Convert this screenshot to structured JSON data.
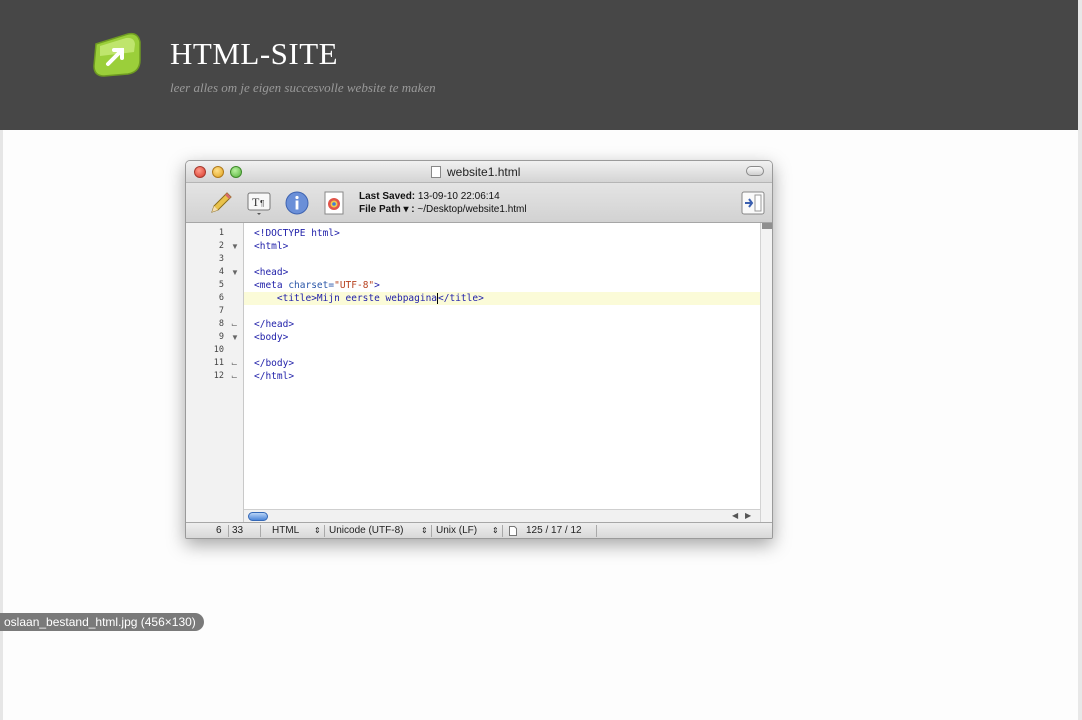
{
  "site": {
    "title": "HTML-SITE",
    "tagline": "leer alles om je eigen succesvolle website te maken",
    "logo_icon": "green-arrow-logo-icon"
  },
  "window": {
    "title": "website1.html",
    "toolbar": {
      "icons": [
        "pencil-icon",
        "text-format-icon",
        "info-icon",
        "preview-icon",
        "split-view-icon"
      ],
      "last_saved_label": "Last Saved:",
      "last_saved_value": "13-09-10 22:06:14",
      "file_path_label": "File Path ▾ :",
      "file_path_value": "~/Desktop/website1.html"
    },
    "editor": {
      "line_numbers": [
        "1",
        "2",
        "3",
        "4",
        "5",
        "6",
        "7",
        "8",
        "9",
        "10",
        "11",
        "12"
      ],
      "lines": {
        "l1": "<!DOCTYPE html>",
        "l2": "<html>",
        "l3": "",
        "l4": "<head>",
        "l5_tag": "<meta ",
        "l5_attr": "charset=",
        "l5_str": "\"UTF-8\"",
        "l5_end": ">",
        "l6_before": "    <title>Mijn eerste webpagina",
        "l6_after": "</title>",
        "l7": "",
        "l8": "</head>",
        "l9": "<body>",
        "l10": "",
        "l11": "</body>",
        "l12": "</html>"
      },
      "current_line": 6
    },
    "statusbar": {
      "line": "6",
      "column": "33",
      "language": "HTML",
      "encoding": "Unicode (UTF-8)",
      "line_endings": "Unix (LF)",
      "counts": "125 / 17 / 12"
    }
  },
  "tooltip": {
    "text": "oslaan_bestand_html.jpg (456×130)"
  },
  "colors": {
    "header_bg": "#474747",
    "page_bg": "#fdfdfd",
    "tag_color": "#2222aa",
    "string_color": "#b7411e",
    "current_line_bg": "#fbfbd8"
  }
}
